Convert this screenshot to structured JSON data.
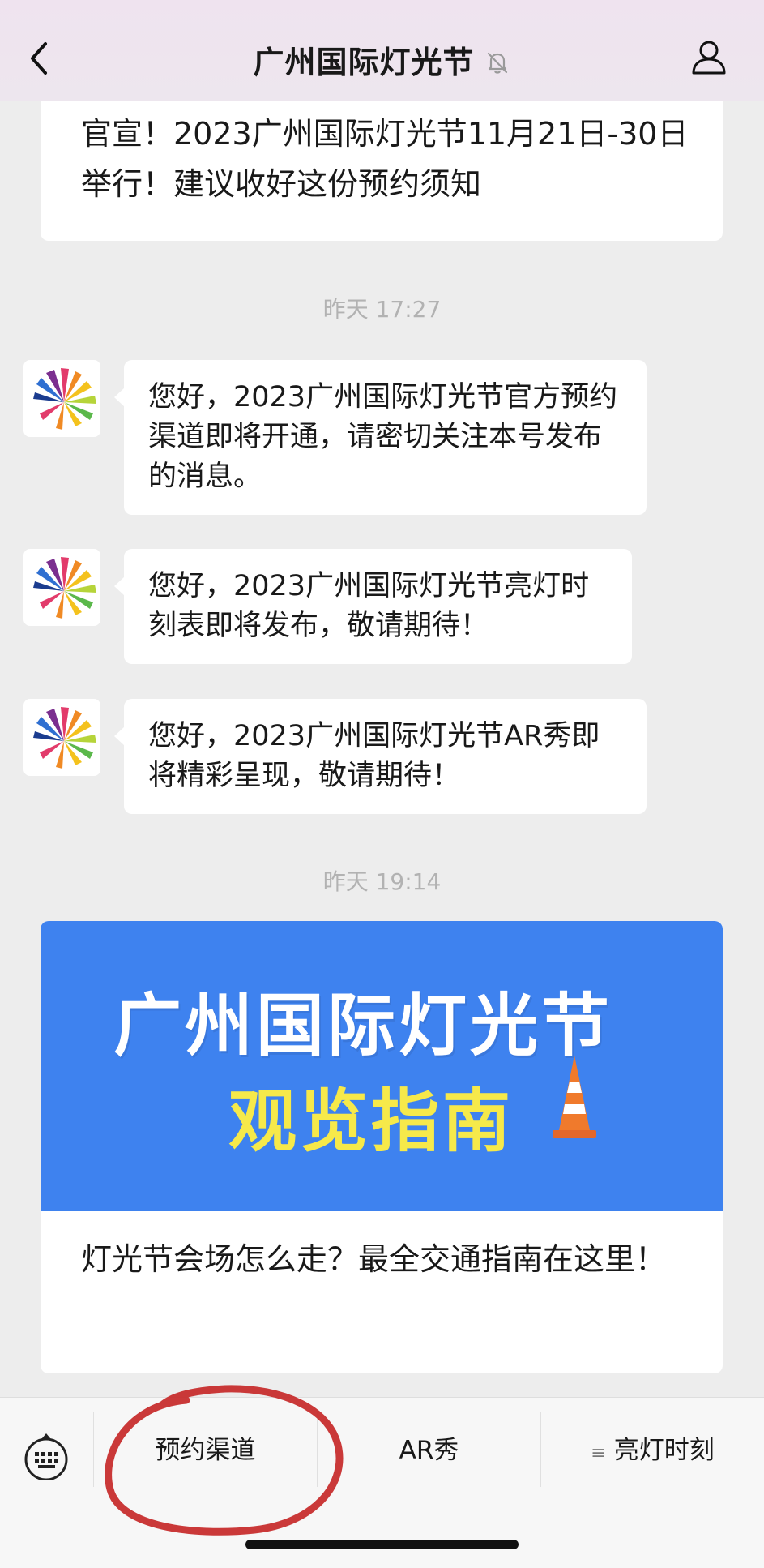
{
  "header": {
    "title": "广州国际灯光节"
  },
  "top_card": {
    "text": "官宣！2023广州国际灯光节11月21日-30日举行！建议收好这份预约须知"
  },
  "timestamps": [
    "昨天 17:27",
    "昨天 19:14"
  ],
  "messages": [
    {
      "text": "您好，2023广州国际灯光节官方预约渠道即将开通，请密切关注本号发布的消息。"
    },
    {
      "text": "您好，2023广州国际灯光节亮灯时刻表即将发布，敬请期待！"
    },
    {
      "text": "您好，2023广州国际灯光节AR秀即将精彩呈现，敬请期待！"
    }
  ],
  "article": {
    "banner_line1": "广州国际灯光节",
    "banner_line2": "观览指南",
    "title": "灯光节会场怎么走？最全交通指南在这里！"
  },
  "menu": {
    "items": [
      "预约渠道",
      "AR秀",
      "亮灯时刻"
    ]
  },
  "colors": {
    "banner_bg": "#3e82ef",
    "banner_highlight": "#f6e94a",
    "annotation_circle": "#c62828"
  }
}
